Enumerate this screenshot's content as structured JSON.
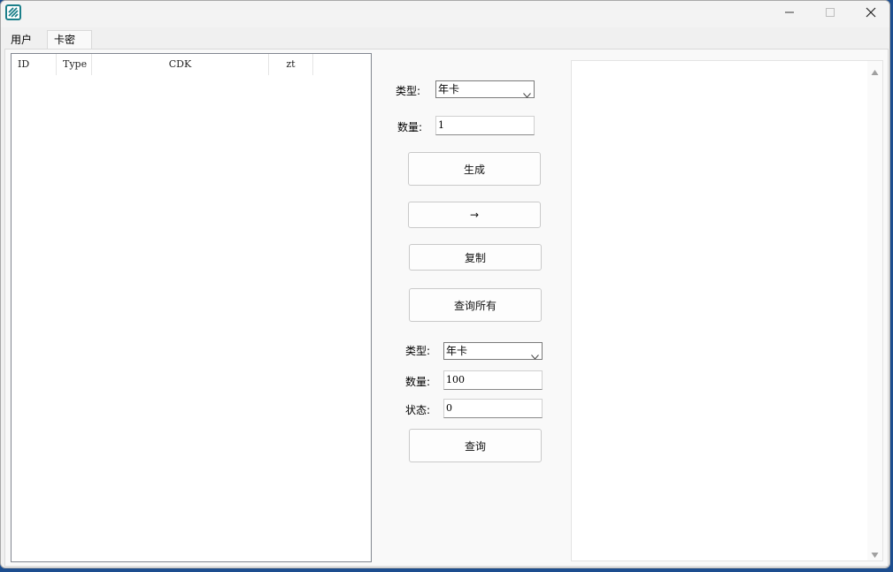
{
  "window": {
    "icon": "app-logo-icon",
    "controls": {
      "minimize": "minimize-icon",
      "maximize": "maximize-icon",
      "close": "close-icon"
    }
  },
  "tabs": [
    {
      "label": "用户",
      "active": false
    },
    {
      "label": "卡密",
      "active": true
    }
  ],
  "list": {
    "columns": [
      "ID",
      "Type",
      "CDK",
      "zt"
    ],
    "rows": []
  },
  "generate": {
    "type_label": "类型:",
    "type_value": "年卡",
    "count_label": "数量:",
    "count_value": "1",
    "generate_button": "生成",
    "arrow_button": "→",
    "copy_button": "复制",
    "query_all_button": "查询所有"
  },
  "query": {
    "type_label": "类型:",
    "type_value": "年卡",
    "count_label": "数量:",
    "count_value": "100",
    "status_label": "状态:",
    "status_value": "0",
    "query_button": "查询"
  },
  "output": {
    "text": ""
  },
  "colors": {
    "window_bg": "#f0f0f0",
    "panel_bg": "#f9f9f9",
    "desktop": "#1d4e8f",
    "icon_teal": "#1b7f8a"
  }
}
